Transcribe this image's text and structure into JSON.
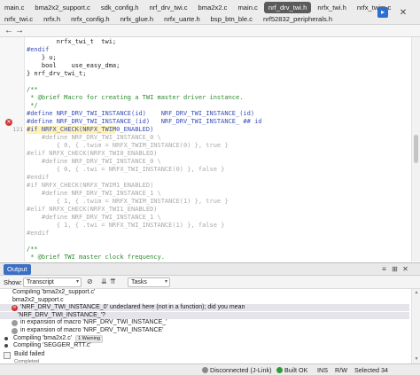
{
  "tabs": {
    "row1": [
      {
        "label": "main.c",
        "active": false
      },
      {
        "label": "bma2x2_support.c",
        "active": false
      },
      {
        "label": "sdk_config.h",
        "active": false
      },
      {
        "label": "nrf_drv_twi.c",
        "active": false
      },
      {
        "label": "bma2x2.c",
        "active": false
      },
      {
        "label": "main.c",
        "active": false
      },
      {
        "label": "nrf_drv_twi.h",
        "active": true
      },
      {
        "label": "nrfx_twi.h",
        "active": false
      },
      {
        "label": "nrfx_twim.c",
        "active": false
      }
    ],
    "row2": [
      {
        "label": "nrfx_twi.c",
        "active": false
      },
      {
        "label": "nrfx.h",
        "active": false
      },
      {
        "label": "nrfx_config.h",
        "active": false
      },
      {
        "label": "nrfx_glue.h",
        "active": false
      },
      {
        "label": "nrfx_uarte.h",
        "active": false
      },
      {
        "label": "bsp_btn_ble.c",
        "active": false
      },
      {
        "label": "nrf52832_peripherals.h",
        "active": false
      }
    ],
    "menu_icon": "arrow-right-box-icon",
    "close_icon": "close-icon"
  },
  "nav": {
    "back_icon": "arrow-left-icon",
    "forward_icon": "arrow-right-icon"
  },
  "editor": {
    "lines": [
      {
        "num": "",
        "text": "        nrfx_twi_t  twi;",
        "style": "norm"
      },
      {
        "num": "",
        "text": "#endif",
        "style": "pre"
      },
      {
        "num": "",
        "text": "    } u;",
        "style": "norm"
      },
      {
        "num": "",
        "text": "    bool    use_easy_dma;",
        "style": "norm"
      },
      {
        "num": "",
        "text": "} nrf_drv_twi_t;",
        "style": "norm"
      },
      {
        "num": "",
        "text": "",
        "style": "norm"
      },
      {
        "num": "",
        "text": "/**",
        "style": "comment"
      },
      {
        "num": "",
        "text": " * @brief Macro for creating a TWI master driver instance.",
        "style": "comment"
      },
      {
        "num": "",
        "text": " */",
        "style": "comment"
      },
      {
        "num": "",
        "text": "#define NRF_DRV_TWI_INSTANCE(id)    NRF_DRV_TWI_INSTANCE_(id)",
        "style": "pre"
      },
      {
        "num": "",
        "text": "#define NRF_DRV_TWI_INSTANCE_(id)   NRF_DRV_TWI_INSTANCE_ ## id",
        "style": "pre",
        "error": true
      },
      {
        "num": "121",
        "text": "#if NRFX_CHECK(NRFX_TWIM0_ENABLED)",
        "style": "pre",
        "highlight": true
      },
      {
        "num": "",
        "text": "    #define NRF_DRV_TWI_INSTANCE_0 \\",
        "style": "dis"
      },
      {
        "num": "",
        "text": "        { 0, { .twim = NRFX_TWIM_INSTANCE(0) }, true }",
        "style": "dis"
      },
      {
        "num": "",
        "text": "#elif NRFX_CHECK(NRFX_TWI0_ENABLED)",
        "style": "dis"
      },
      {
        "num": "",
        "text": "    #define NRF_DRV_TWI_INSTANCE_0 \\",
        "style": "dis"
      },
      {
        "num": "",
        "text": "        { 0, { .twi = NRFX_TWI_INSTANCE(0) }, false }",
        "style": "dis"
      },
      {
        "num": "",
        "text": "#endif",
        "style": "dis"
      },
      {
        "num": "",
        "text": "#if NRFX_CHECK(NRFX_TWIM1_ENABLED)",
        "style": "dis"
      },
      {
        "num": "",
        "text": "    #define NRF_DRV_TWI_INSTANCE_1 \\",
        "style": "dis"
      },
      {
        "num": "",
        "text": "        { 1, { .twim = NRFX_TWIM_INSTANCE(1) }, true }",
        "style": "dis"
      },
      {
        "num": "",
        "text": "#elif NRFX_CHECK(NRFX_TWI1_ENABLED)",
        "style": "dis"
      },
      {
        "num": "",
        "text": "    #define NRF_DRV_TWI_INSTANCE_1 \\",
        "style": "dis"
      },
      {
        "num": "",
        "text": "        { 1, { .twi = NRFX_TWI_INSTANCE(1) }, false }",
        "style": "dis"
      },
      {
        "num": "",
        "text": "#endif",
        "style": "dis"
      },
      {
        "num": "",
        "text": "",
        "style": "norm"
      },
      {
        "num": "",
        "text": "/**",
        "style": "comment"
      },
      {
        "num": "",
        "text": " * @brief TWI master clock frequency.",
        "style": "comment"
      },
      {
        "num": "",
        "text": " */",
        "style": "comment"
      }
    ]
  },
  "output": {
    "title": "Output",
    "show_label": "Show:",
    "show_value": "Transcript",
    "filter_value": "Tasks",
    "lines": [
      {
        "indent": 14,
        "icon": "none",
        "text": "Compiling 'bma2x2_support.c'",
        "partial": true
      },
      {
        "indent": 14,
        "icon": "none",
        "text": "bma2x2_support.c"
      },
      {
        "indent": 14,
        "icon": "err",
        "text": "'NRF_DRV_TWI_INSTANCE_0' undeclared here (not in a function); did you mean",
        "selected": true
      },
      {
        "indent": 20,
        "icon": "none",
        "text": "'NRF_DRV_TWI_INSTANCE_'?",
        "selected": true
      },
      {
        "indent": 14,
        "icon": "info",
        "text": "in expansion of macro 'NRF_DRV_TWI_INSTANCE_'"
      },
      {
        "indent": 14,
        "icon": "info",
        "text": "in expansion of macro 'NRF_DRV_TWI_INSTANCE'"
      },
      {
        "indent": 6,
        "icon": "dot",
        "text": "Compiling 'bma2x2.c'",
        "badge": "1 Warning"
      },
      {
        "indent": 6,
        "icon": "dot",
        "text": "Compiling 'SEGGER_RTT.c'"
      }
    ],
    "build_status": "Build failed",
    "build_sub": "Completed"
  },
  "status": {
    "connection": "Disconnected (J-Link)",
    "build": "Built OK",
    "ins": "INS",
    "mode": "R/W",
    "selected": "Selected 34"
  },
  "colors": {
    "error": "#d33a3a",
    "ok": "#2f9a3a",
    "disconnected": "#8a8a8a",
    "active_tab": "#5b5b5b",
    "highlight": "#fff2b3"
  }
}
